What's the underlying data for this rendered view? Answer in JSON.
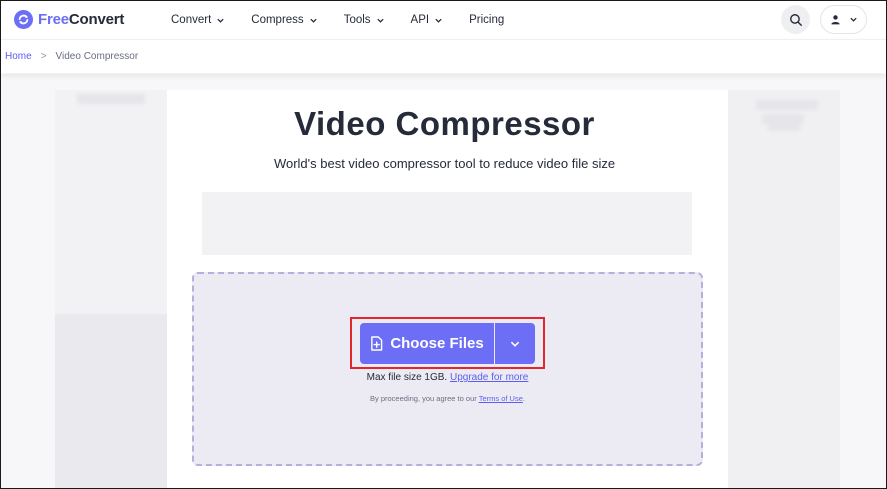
{
  "brand": {
    "part1": "Free",
    "part2": "Convert",
    "accent": "#6c6ef5"
  },
  "nav": {
    "items": [
      {
        "label": "Convert",
        "has_dropdown": true
      },
      {
        "label": "Compress",
        "has_dropdown": true
      },
      {
        "label": "Tools",
        "has_dropdown": true
      },
      {
        "label": "API",
        "has_dropdown": true
      },
      {
        "label": "Pricing",
        "has_dropdown": false
      }
    ],
    "search_icon": "search-icon",
    "user_icon": "user-icon"
  },
  "breadcrumb": {
    "home": "Home",
    "separator": ">",
    "current": "Video Compressor"
  },
  "main": {
    "title": "Video Compressor",
    "subtitle": "World's best video compressor tool to reduce video file size",
    "choose_files_label": "Choose Files",
    "max_size_text": "Max file size 1GB.",
    "upgrade_link": "Upgrade for more",
    "agree_text": "By proceeding, you agree to our",
    "terms_link": "Terms of Use",
    "agree_end": "."
  },
  "colors": {
    "button": "#6c6ef5",
    "highlight_border": "#e3262b",
    "dropzone_bg": "#ecebf3"
  }
}
